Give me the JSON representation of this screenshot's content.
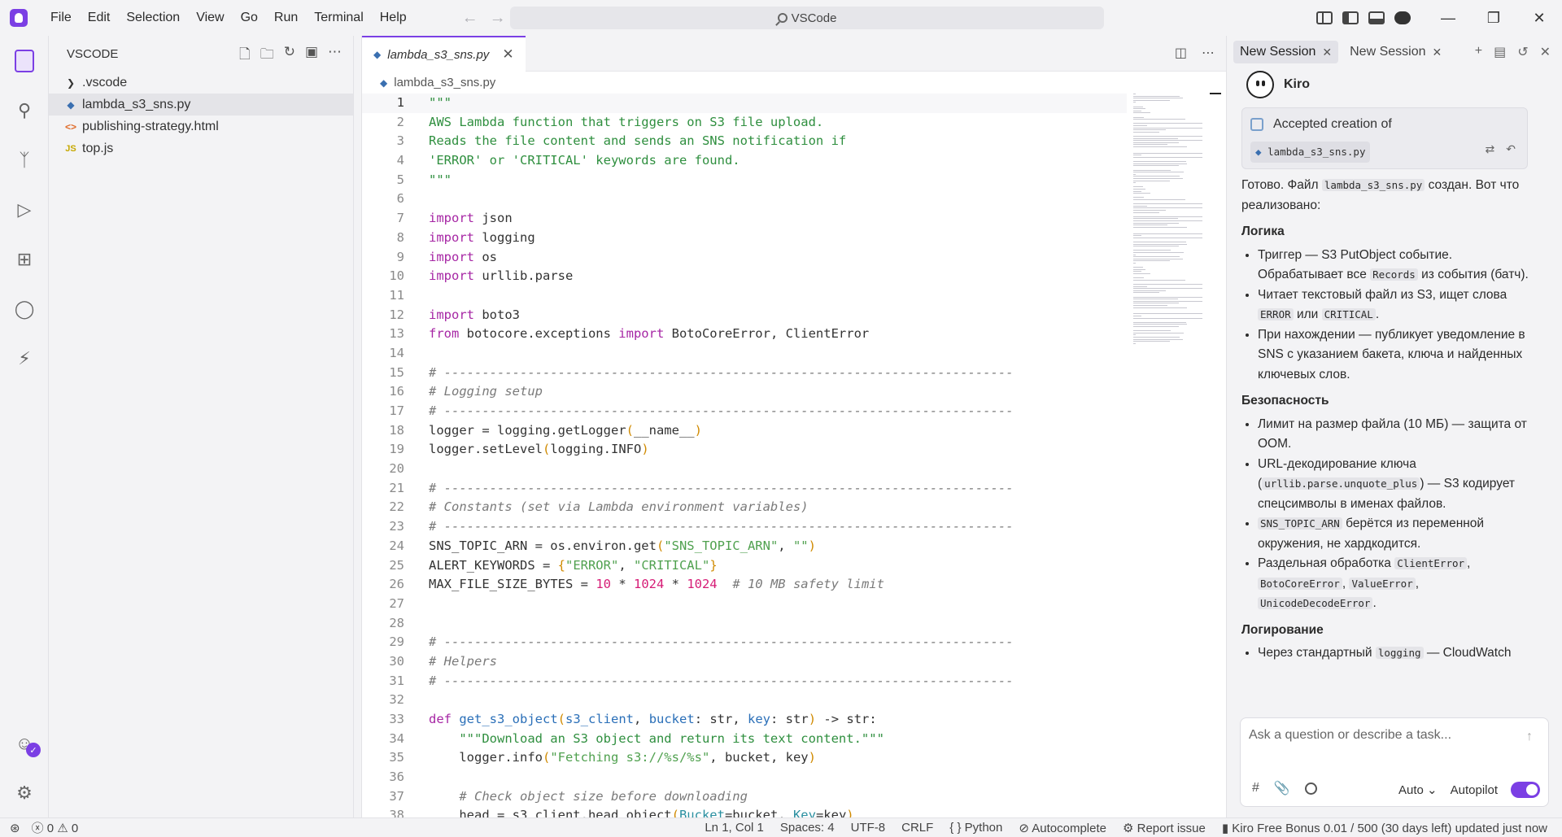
{
  "menu": [
    "File",
    "Edit",
    "Selection",
    "View",
    "Go",
    "Run",
    "Terminal",
    "Help"
  ],
  "command_center": "VSCode",
  "sidebar": {
    "title": "VSCODE",
    "items": [
      {
        "label": ".vscode",
        "icon": "chevron-right-icon"
      },
      {
        "label": "lambda_s3_sns.py",
        "icon": "python-icon"
      },
      {
        "label": "publishing-strategy.html",
        "icon": "html-icon"
      },
      {
        "label": "top.js",
        "icon": "js-icon"
      }
    ]
  },
  "editor": {
    "tab_label": "lambda_s3_sns.py",
    "breadcrumb": "lambda_s3_sns.py",
    "lines": [
      [
        [
          "doc",
          "\"\"\""
        ]
      ],
      [
        [
          "doc",
          "AWS Lambda function that triggers on S3 file upload."
        ]
      ],
      [
        [
          "doc",
          "Reads the file content and sends an SNS notification if"
        ]
      ],
      [
        [
          "doc",
          "'ERROR' or 'CRITICAL' keywords are found."
        ]
      ],
      [
        [
          "doc",
          "\"\"\""
        ]
      ],
      [],
      [
        [
          "kw",
          "import"
        ],
        [
          "t",
          " json"
        ]
      ],
      [
        [
          "kw",
          "import"
        ],
        [
          "t",
          " logging"
        ]
      ],
      [
        [
          "kw",
          "import"
        ],
        [
          "t",
          " os"
        ]
      ],
      [
        [
          "kw",
          "import"
        ],
        [
          "t",
          " urllib.parse"
        ]
      ],
      [],
      [
        [
          "kw",
          "import"
        ],
        [
          "t",
          " boto3"
        ]
      ],
      [
        [
          "kw",
          "from"
        ],
        [
          "t",
          " botocore.exceptions "
        ],
        [
          "kw",
          "import"
        ],
        [
          "t",
          " BotoCoreError, ClientError"
        ]
      ],
      [],
      [
        [
          "cm",
          "# ---------------------------------------------------------------------------"
        ]
      ],
      [
        [
          "cm",
          "# Logging setup"
        ]
      ],
      [
        [
          "cm",
          "# ---------------------------------------------------------------------------"
        ]
      ],
      [
        [
          "t",
          "logger = logging.getLogger"
        ],
        [
          "brk",
          "("
        ],
        [
          "t",
          "__name__"
        ],
        [
          "brk",
          ")"
        ]
      ],
      [
        [
          "t",
          "logger.setLevel"
        ],
        [
          "brk",
          "("
        ],
        [
          "t",
          "logging.INFO"
        ],
        [
          "brk",
          ")"
        ]
      ],
      [],
      [
        [
          "cm",
          "# ---------------------------------------------------------------------------"
        ]
      ],
      [
        [
          "cm",
          "# Constants (set via Lambda environment variables)"
        ]
      ],
      [
        [
          "cm",
          "# ---------------------------------------------------------------------------"
        ]
      ],
      [
        [
          "t",
          "SNS_TOPIC_ARN = os.environ.get"
        ],
        [
          "brk",
          "("
        ],
        [
          "str",
          "\"SNS_TOPIC_ARN\""
        ],
        [
          "t",
          ", "
        ],
        [
          "str",
          "\"\""
        ],
        [
          "brk",
          ")"
        ]
      ],
      [
        [
          "t",
          "ALERT_KEYWORDS = "
        ],
        [
          "brk",
          "{"
        ],
        [
          "str",
          "\"ERROR\""
        ],
        [
          "t",
          ", "
        ],
        [
          "str",
          "\"CRITICAL\""
        ],
        [
          "brk",
          "}"
        ]
      ],
      [
        [
          "t",
          "MAX_FILE_SIZE_BYTES = "
        ],
        [
          "num",
          "10"
        ],
        [
          "t",
          " * "
        ],
        [
          "num",
          "1024"
        ],
        [
          "t",
          " * "
        ],
        [
          "num",
          "1024"
        ],
        [
          "t",
          "  "
        ],
        [
          "cm",
          "# 10 MB safety limit"
        ]
      ],
      [],
      [],
      [
        [
          "cm",
          "# ---------------------------------------------------------------------------"
        ]
      ],
      [
        [
          "cm",
          "# Helpers"
        ]
      ],
      [
        [
          "cm",
          "# ---------------------------------------------------------------------------"
        ]
      ],
      [],
      [
        [
          "kw",
          "def"
        ],
        [
          "t",
          " "
        ],
        [
          "fn",
          "get_s3_object"
        ],
        [
          "brk",
          "("
        ],
        [
          "prm",
          "s3_client"
        ],
        [
          "t",
          ", "
        ],
        [
          "prm",
          "bucket"
        ],
        [
          "t",
          ": str, "
        ],
        [
          "prm",
          "key"
        ],
        [
          "t",
          ": str"
        ],
        [
          "brk",
          ")"
        ],
        [
          "t",
          " -> str:"
        ]
      ],
      [
        [
          "t",
          "    "
        ],
        [
          "doc",
          "\"\"\"Download an S3 object and return its text content.\"\"\""
        ]
      ],
      [
        [
          "t",
          "    logger.info"
        ],
        [
          "brk",
          "("
        ],
        [
          "str",
          "\"Fetching s3://%s/%s\""
        ],
        [
          "t",
          ", bucket, key"
        ],
        [
          "brk",
          ")"
        ]
      ],
      [],
      [
        [
          "t",
          "    "
        ],
        [
          "cm",
          "# Check object size before downloading"
        ]
      ],
      [
        [
          "t",
          "    head = s3_client.head_object"
        ],
        [
          "brk",
          "("
        ],
        [
          "cls",
          "Bucket"
        ],
        [
          "t",
          "=bucket, "
        ],
        [
          "cls",
          "Key"
        ],
        [
          "t",
          "=key"
        ],
        [
          "brk",
          ")"
        ]
      ]
    ]
  },
  "chat": {
    "tabs": [
      "New Session",
      "New Session"
    ],
    "agent_name": "Kiro",
    "accepted_title": "Accepted creation of",
    "accepted_file": "lambda_s3_sns.py",
    "intro": [
      [
        "t",
        "Готово. Файл "
      ],
      [
        "c",
        "lambda_s3_sns.py"
      ],
      [
        "t",
        " создан. Вот что реализовано:"
      ]
    ],
    "sections": [
      {
        "heading": "Логика",
        "bullets": [
          [
            [
              "t",
              "Триггер — S3 PutObject событие. Обрабатывает все "
            ],
            [
              "c",
              "Records"
            ],
            [
              "t",
              " из события (батч)."
            ]
          ],
          [
            [
              "t",
              "Читает текстовый файл из S3, ищет слова "
            ],
            [
              "c",
              "ERROR"
            ],
            [
              "t",
              " или "
            ],
            [
              "c",
              "CRITICAL"
            ],
            [
              "t",
              "."
            ]
          ],
          [
            [
              "t",
              "При нахождении — публикует уведомление в SNS с указанием бакета, ключа и найденных ключевых слов."
            ]
          ]
        ]
      },
      {
        "heading": "Безопасность",
        "bullets": [
          [
            [
              "t",
              "Лимит на размер файла (10 МБ) — защита от OOM."
            ]
          ],
          [
            [
              "t",
              "URL-декодирование ключа ("
            ],
            [
              "c",
              "urllib.parse.unquote_plus"
            ],
            [
              "t",
              ") — S3 кодирует спецсимволы в именах файлов."
            ]
          ],
          [
            [
              "c",
              "SNS_TOPIC_ARN"
            ],
            [
              "t",
              " берётся из переменной окружения, не хардкодится."
            ]
          ],
          [
            [
              "t",
              "Раздельная обработка "
            ],
            [
              "c",
              "ClientError"
            ],
            [
              "t",
              ", "
            ],
            [
              "c",
              "BotoCoreError"
            ],
            [
              "t",
              ", "
            ],
            [
              "c",
              "ValueError"
            ],
            [
              "t",
              ", "
            ],
            [
              "c",
              "UnicodeDecodeError"
            ],
            [
              "t",
              "."
            ]
          ]
        ]
      },
      {
        "heading": "Логирование",
        "bullets": [
          [
            [
              "t",
              "Через стандартный "
            ],
            [
              "c",
              "logging"
            ],
            [
              "t",
              " — CloudWatch"
            ]
          ]
        ]
      }
    ],
    "input_placeholder": "Ask a question or describe a task...",
    "mode": "Auto",
    "autopilot_label": "Autopilot",
    "autopilot_on": true
  },
  "status": {
    "errors": "0",
    "warnings": "0",
    "position": "Ln 1, Col 1",
    "spaces": "Spaces: 4",
    "encoding": "UTF-8",
    "eol": "CRLF",
    "language": "Python",
    "autocomplete": "Autocomplete",
    "report": "Report issue",
    "kiro_status": "Kiro Free Bonus 0.01 / 500 (30 days left) updated just now"
  },
  "colors": {
    "accent": "#7b3fe4",
    "comment": "#7a7a7a",
    "string": "#50a14f",
    "keyword": "#a626a4",
    "number": "#d61c76"
  }
}
